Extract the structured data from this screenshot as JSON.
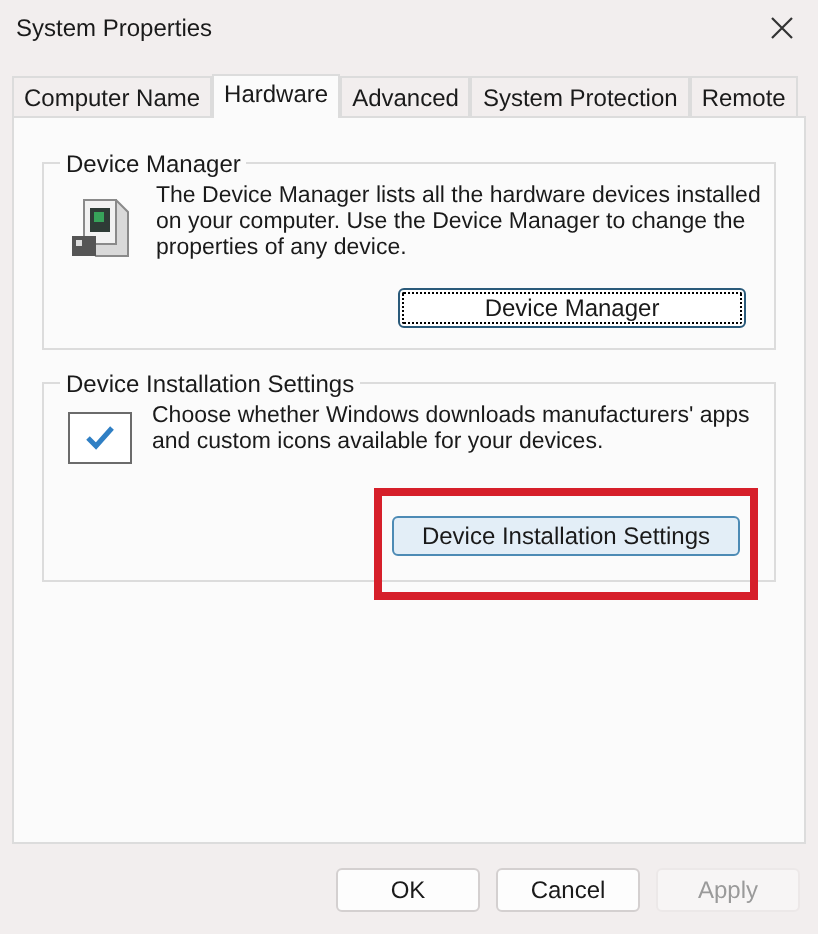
{
  "window": {
    "title": "System Properties"
  },
  "tabs": [
    {
      "label": "Computer Name",
      "selected": false
    },
    {
      "label": "Hardware",
      "selected": true
    },
    {
      "label": "Advanced",
      "selected": false
    },
    {
      "label": "System Protection",
      "selected": false
    },
    {
      "label": "Remote",
      "selected": false
    }
  ],
  "groups": [
    {
      "kind": "device-manager",
      "title": "Device Manager",
      "text": "The Device Manager lists all the hardware devices installed on your computer. Use the Device Manager to change the properties of any device.",
      "button": {
        "label": "Device Manager",
        "focused": true,
        "highlighted": false
      }
    },
    {
      "kind": "installation",
      "title": "Device Installation Settings",
      "text": "Choose whether Windows downloads manufacturers' apps and custom icons available for your devices.",
      "button": {
        "label": "Device Installation Settings",
        "focused": false,
        "highlighted": true
      }
    }
  ],
  "buttons": [
    {
      "label": "OK",
      "disabled": false
    },
    {
      "label": "Cancel",
      "disabled": false
    },
    {
      "label": "Apply",
      "disabled": true
    }
  ]
}
